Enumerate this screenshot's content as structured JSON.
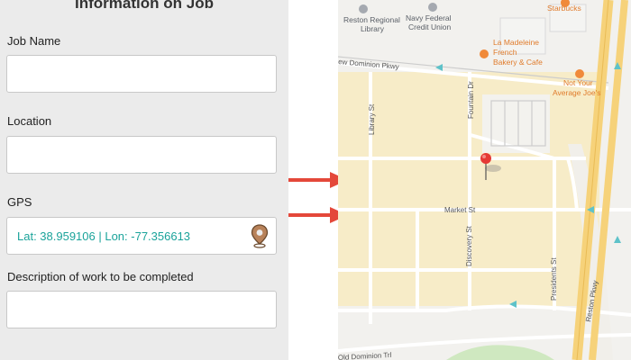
{
  "form": {
    "title": "Information on Job",
    "job_name": {
      "label": "Job Name",
      "value": ""
    },
    "location": {
      "label": "Location",
      "value": ""
    },
    "gps": {
      "label": "GPS",
      "value": "Lat: 38.959106 | Lon: -77.356613"
    },
    "description": {
      "label": "Description of work to be completed",
      "value": ""
    }
  },
  "map": {
    "places": [
      {
        "name_line1": "Reston Regional",
        "name_line2": "Library"
      },
      {
        "name_line1": "Navy Federal",
        "name_line2": "Credit Union"
      },
      {
        "name_line1": "Starbucks"
      },
      {
        "name_line1": "La Madeleine",
        "name_line2": "French",
        "name_line3": "Bakery & Cafe"
      },
      {
        "name_line1": "Not Your",
        "name_line2": "Average Joe's"
      }
    ],
    "streets": {
      "new_dominion": "ew Dominion Pkwy",
      "library": "Library St",
      "fountain": "Fountain Dr",
      "market": "Market St",
      "discovery": "Discovery St",
      "presidents": "Presidents St",
      "reston": "Reston Pkwy",
      "old_dominion": "Old Dominion Trl"
    }
  },
  "colors": {
    "accent": "#1aa39a",
    "arrow": "#e4483a",
    "pin": "#e53935",
    "block": "#f7ecc8",
    "road": "#ffffff",
    "major_road": "#f6d27a"
  }
}
